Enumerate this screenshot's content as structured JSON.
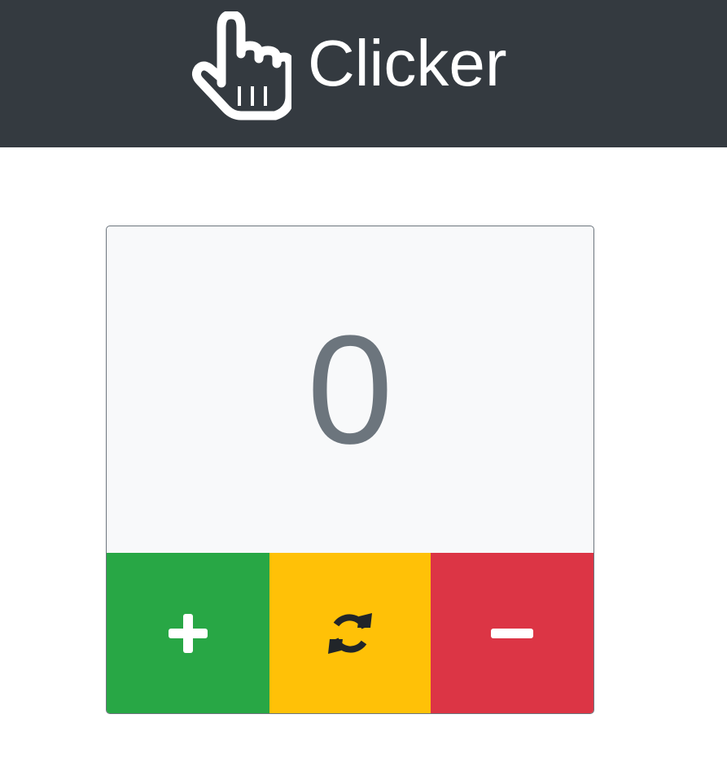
{
  "header": {
    "title": "Clicker",
    "icon": "pointing-hand-icon",
    "background": "#343a40"
  },
  "counter": {
    "value": "0",
    "color": "#6c757d"
  },
  "buttons": [
    {
      "action": "increment",
      "icon": "plus-icon",
      "color": "#28a745"
    },
    {
      "action": "reset",
      "icon": "sync-icon",
      "color": "#ffc107"
    },
    {
      "action": "decrement",
      "icon": "minus-icon",
      "color": "#dc3545"
    }
  ]
}
